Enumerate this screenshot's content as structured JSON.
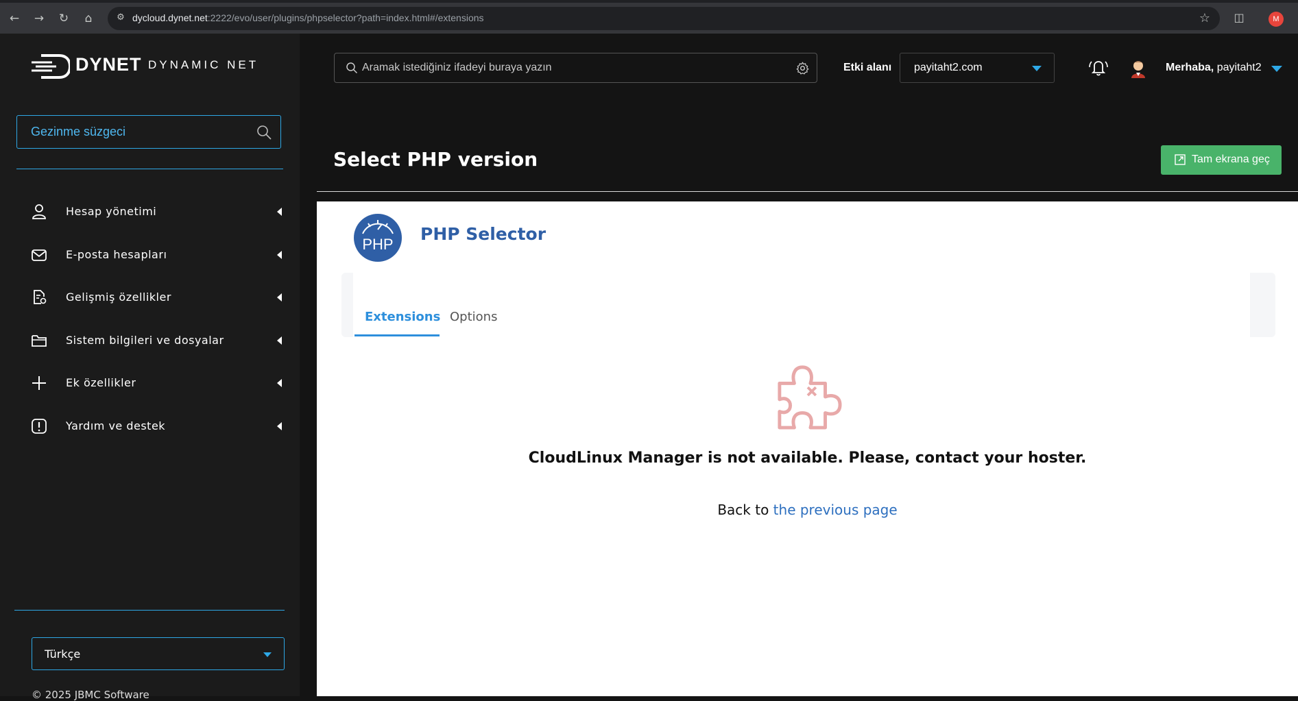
{
  "browser": {
    "url_host": "dycloud.dynet.net",
    "url_rest": ":2222/evo/user/plugins/phpselector?path=index.html#/extensions",
    "profile_initial": "M"
  },
  "sidebar": {
    "logo_text": "DYNET",
    "logo_subtext": "DYNAMIC NET",
    "filter_placeholder": "Gezinme süzgeci",
    "items": [
      {
        "label": "Hesap yönetimi",
        "icon": "user-icon"
      },
      {
        "label": "E-posta hesapları",
        "icon": "mail-icon"
      },
      {
        "label": "Gelişmiş özellikler",
        "icon": "advanced-doc-icon"
      },
      {
        "label": "Sistem bilgileri ve dosyalar",
        "icon": "folder-icon"
      },
      {
        "label": "Ek özellikler",
        "icon": "plus-icon"
      },
      {
        "label": "Yardım ve destek",
        "icon": "alert-icon"
      }
    ],
    "language": "Türkçe",
    "copyright": "© 2025 JBMC Software"
  },
  "header": {
    "search_placeholder": "Aramak istediğiniz ifadeyi buraya yazın",
    "domain_label": "Etki alanı",
    "domain_value": "payitaht2.com",
    "greeting_bold": "Merhaba,",
    "greeting_user": "payitaht2"
  },
  "page": {
    "title": "Select PHP version",
    "fullscreen_label": "Tam ekrana geç"
  },
  "plugin": {
    "logo_text": "PHP",
    "title": "PHP Selector",
    "tabs": [
      {
        "label": "Extensions",
        "active": true
      },
      {
        "label": "Options",
        "active": false
      }
    ],
    "error_message": "CloudLinux Manager is not available. Please, contact your hoster.",
    "back_prefix": "Back to",
    "back_link": "the previous page"
  },
  "colors": {
    "accent": "#2ea8e6",
    "fullscreen_btn": "#49b36a",
    "plugin_title": "#2f5fa6",
    "error_icon": "#e8a9a9"
  }
}
